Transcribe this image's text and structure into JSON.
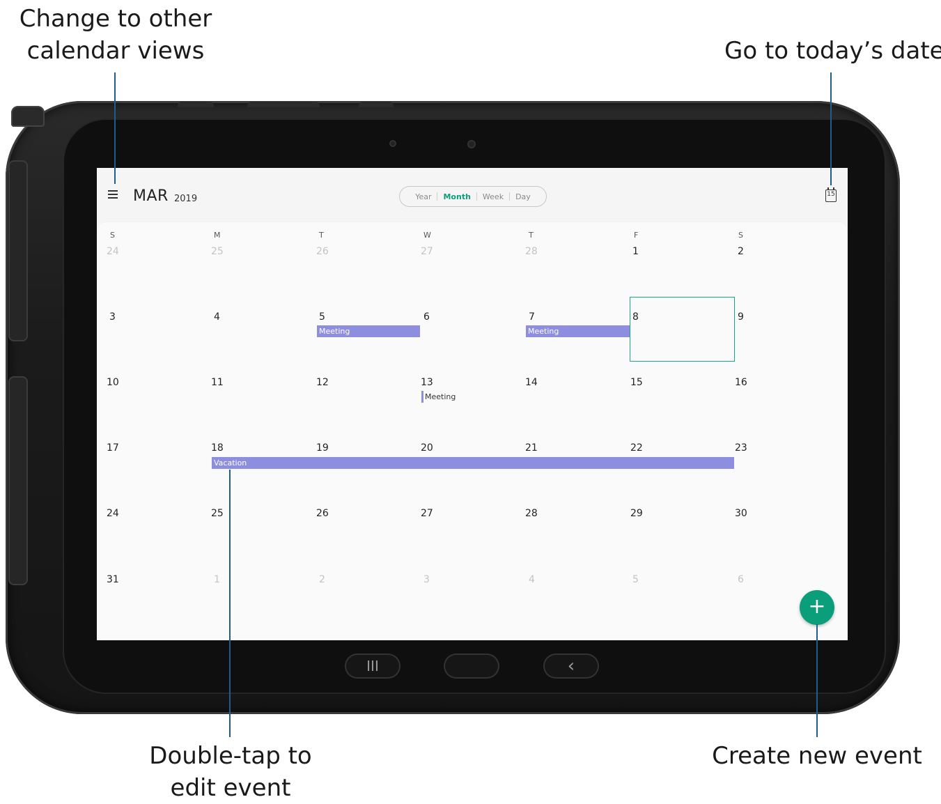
{
  "callouts": {
    "views_line1": "Change to other",
    "views_line2": "calendar views",
    "today": "Go to today’s date",
    "edit_line1": "Double-tap to",
    "edit_line2": "edit event",
    "create": "Create new event"
  },
  "header": {
    "menu_icon": "hamburger-menu-icon",
    "month": "MAR",
    "year": "2019",
    "views": [
      "Year",
      "Month",
      "Week",
      "Day"
    ],
    "active_view": "Month",
    "today_icon_text": "15"
  },
  "weekdays": [
    "S",
    "M",
    "T",
    "W",
    "T",
    "F",
    "S"
  ],
  "weeks": [
    [
      "24",
      "25",
      "26",
      "27",
      "28",
      "1",
      "2"
    ],
    [
      "3",
      "4",
      "5",
      "6",
      "7",
      "8",
      "9"
    ],
    [
      "10",
      "11",
      "12",
      "13",
      "14",
      "15",
      "16"
    ],
    [
      "17",
      "18",
      "19",
      "20",
      "21",
      "22",
      "23"
    ],
    [
      "24",
      "25",
      "26",
      "27",
      "28",
      "29",
      "30"
    ],
    [
      "31",
      "1",
      "2",
      "3",
      "4",
      "5",
      "6"
    ]
  ],
  "events": {
    "e1": "Meeting",
    "e2": "Meeting",
    "e3": "Meeting",
    "e4": "Vacation"
  },
  "fab": {
    "label": "+"
  },
  "nav": {
    "recents": "III",
    "back": "‹"
  },
  "colors": {
    "accent": "#0b9e7a",
    "event": "#8e8ee0",
    "callout_line": "#1d5e8c"
  }
}
